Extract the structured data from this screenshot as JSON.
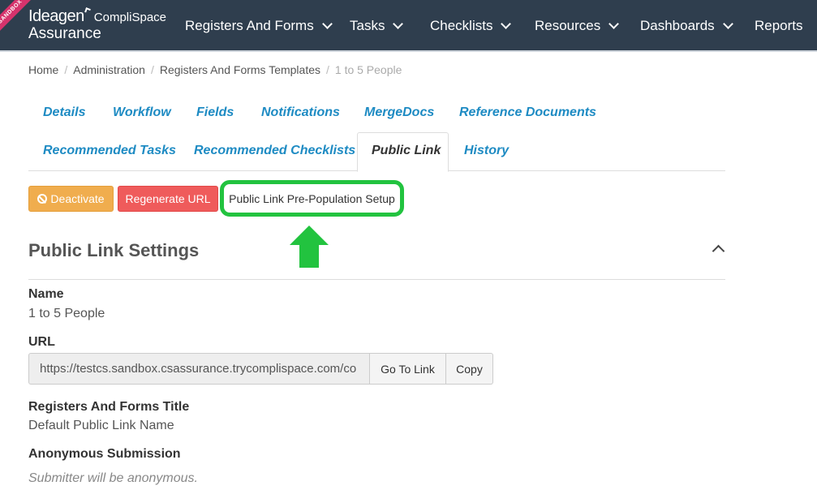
{
  "header": {
    "ribbon": "SANDBOX",
    "logo_brand": "Ideagen",
    "logo_sub": "CompliSpace",
    "logo_product": "Assurance",
    "nav": [
      {
        "label": "Registers And Forms",
        "dropdown": true
      },
      {
        "label": "Tasks",
        "dropdown": true
      },
      {
        "label": "Checklists",
        "dropdown": true
      },
      {
        "label": "Resources",
        "dropdown": true
      },
      {
        "label": "Dashboards",
        "dropdown": true
      },
      {
        "label": "Reports",
        "dropdown": false
      }
    ]
  },
  "breadcrumb": [
    "Home",
    "Administration",
    "Registers And Forms Templates",
    "1 to 5 People"
  ],
  "tabs": [
    "Details",
    "Workflow",
    "Fields",
    "Notifications",
    "MergeDocs",
    "Reference Documents",
    "Recommended Tasks",
    "Recommended Checklists",
    "Public Link",
    "History"
  ],
  "active_tab": "Public Link",
  "actions": {
    "deactivate": "Deactivate",
    "regenerate": "Regenerate URL",
    "prepopulation": "Public Link Pre-Population Setup"
  },
  "section": {
    "title": "Public Link Settings",
    "name_label": "Name",
    "name_value": "1 to 5 People",
    "url_label": "URL",
    "url_value": "https://testcs.sandbox.csassurance.trycomplispace.com/co",
    "go_to_link": "Go To Link",
    "copy": "Copy",
    "title_label": "Registers And Forms Title",
    "title_value": "Default Public Link Name",
    "anon_label": "Anonymous Submission",
    "anon_value": "Submitter will be anonymous."
  },
  "colors": {
    "nav_bg": "#2f3e4e",
    "link": "#1e8bc3",
    "warning": "#f0ad4e",
    "danger": "#ef5b5b",
    "highlight": "#22c33f"
  }
}
